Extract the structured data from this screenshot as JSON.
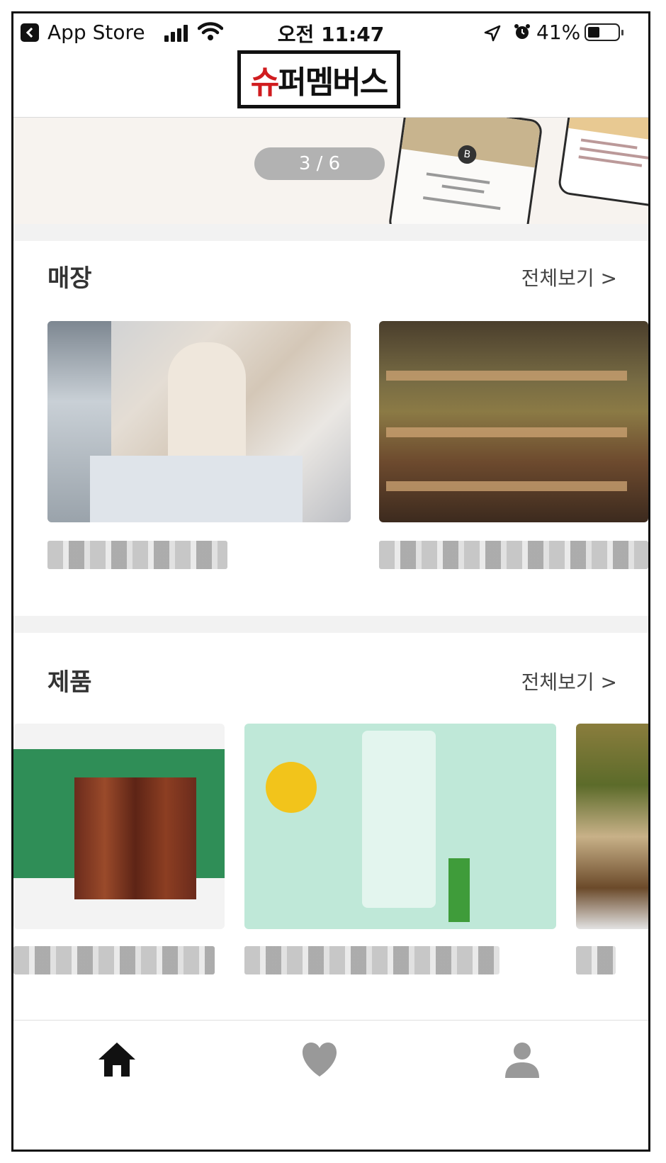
{
  "status_bar": {
    "back_app": "App Store",
    "time": "오전 11:47",
    "battery": "41%",
    "battery_level": 0.41
  },
  "header": {
    "logo_text": "슈퍼멤버스"
  },
  "banner": {
    "pager": "3 / 6"
  },
  "stores": {
    "title": "매장",
    "see_all": "전체보기 >"
  },
  "products": {
    "title": "제품",
    "see_all": "전체보기 >"
  },
  "tabbar": {
    "items": [
      "home-icon",
      "heart-icon",
      "profile-icon"
    ],
    "active_color": "#111111",
    "inactive_color": "#999999"
  }
}
